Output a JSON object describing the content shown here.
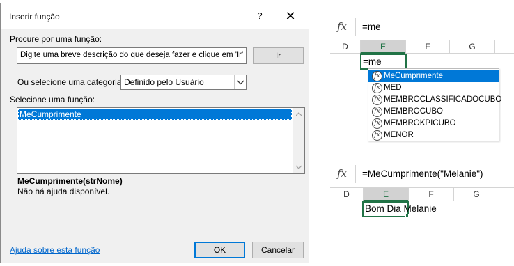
{
  "dialog": {
    "title": "Inserir função",
    "help_glyph": "?",
    "close_glyph": "✕",
    "search_label": "Procure por uma função:",
    "search_value": "Digite uma breve descrição do que deseja fazer e clique em 'Ir'",
    "go_button": "Ir",
    "category_label": "Ou selecione uma categoria:",
    "category_value": "Definido pelo Usuário",
    "function_list_label": "Selecione uma função:",
    "functions": [
      "MeCumprimente"
    ],
    "signature": "MeCumprimente(strNome)",
    "description": "Não há ajuda disponível.",
    "help_link": "Ajuda sobre esta função",
    "ok_button": "OK",
    "cancel_button": "Cancelar"
  },
  "excel_top": {
    "fx_label": "fx",
    "formula": "=me",
    "columns": [
      "D",
      "E",
      "F",
      "G"
    ],
    "active_column": "E",
    "cell_text": "=me",
    "autocomplete": [
      "MeCumprimente",
      "MED",
      "MEMBROCLASSIFICADOCUBO",
      "MEMBROCUBO",
      "MEMBROKPICUBO",
      "MENOR"
    ],
    "autocomplete_selected": "MeCumprimente"
  },
  "excel_bottom": {
    "fx_label": "fx",
    "formula": "=MeCumprimente(\"Melanie\")",
    "columns": [
      "D",
      "E",
      "F",
      "G"
    ],
    "active_column": "E",
    "cell_text": "Bom Dia Melanie"
  },
  "colors": {
    "accent_blue": "#0078d7",
    "excel_green": "#217346",
    "link": "#0066cc"
  }
}
